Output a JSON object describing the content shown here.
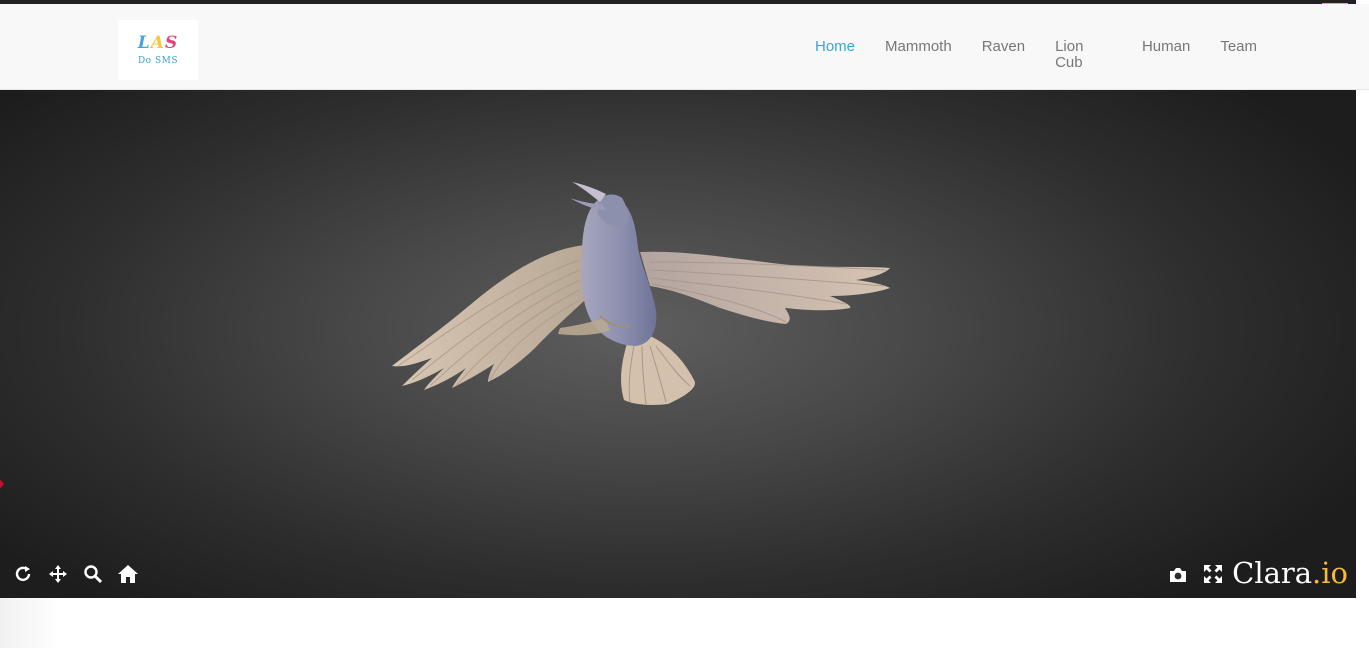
{
  "logo": {
    "mark_letters": [
      "L",
      "A",
      "S"
    ],
    "subtitle": "Do SMS"
  },
  "nav": {
    "items": [
      {
        "label": "Home",
        "active": true
      },
      {
        "label": "Mammoth",
        "active": false
      },
      {
        "label": "Raven",
        "active": false
      },
      {
        "label": "Lion Cub",
        "active": false
      },
      {
        "label": "Human",
        "active": false
      },
      {
        "label": "Team",
        "active": false
      }
    ]
  },
  "viewer": {
    "model": "raven",
    "controls_left": [
      "rotate-icon",
      "pan-icon",
      "zoom-icon",
      "home-icon"
    ],
    "controls_right": [
      "camera-icon",
      "fullscreen-icon"
    ],
    "brand": {
      "name": "Clara",
      "suffix": ".io"
    }
  },
  "colors": {
    "nav_active": "#33a9d6",
    "nav_default": "#777777",
    "brand_suffix": "#f6b93b",
    "model": "#cbb8a6"
  }
}
